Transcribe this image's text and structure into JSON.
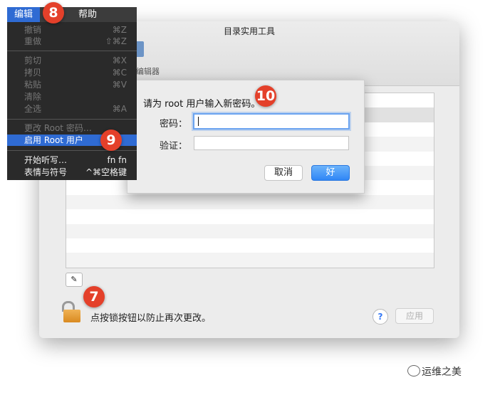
{
  "window": {
    "title": "目录实用工具",
    "toolbar_label": "编辑器",
    "lock_text": "点按锁按钮以防止再次更改。",
    "help_label": "?",
    "apply_label": "应用",
    "edit_icon": "✎"
  },
  "dialog": {
    "title": "请为 root 用户输入新密码。",
    "password_label": "密码：",
    "verify_label": "验证：",
    "cancel_label": "取消",
    "ok_label": "好"
  },
  "menubar": {
    "edit": "编辑",
    "help": "帮助"
  },
  "menu": {
    "items": [
      {
        "label": "撤销",
        "shortcut": "⌘Z"
      },
      {
        "label": "重做",
        "shortcut": "⇧⌘Z"
      },
      {
        "label": "剪切",
        "shortcut": "⌘X"
      },
      {
        "label": "拷贝",
        "shortcut": "⌘C"
      },
      {
        "label": "粘贴",
        "shortcut": "⌘V"
      },
      {
        "label": "清除",
        "shortcut": ""
      },
      {
        "label": "全选",
        "shortcut": "⌘A"
      },
      {
        "label": "更改 Root 密码…",
        "shortcut": ""
      },
      {
        "label": "启用 Root 用户",
        "shortcut": ""
      },
      {
        "label": "开始听写…",
        "shortcut": "fn fn"
      },
      {
        "label": "表情与符号",
        "shortcut": "^⌘空格键"
      }
    ]
  },
  "badges": {
    "b7": "7",
    "b8": "8",
    "b9": "9",
    "b10": "10"
  },
  "watermark": "运维之美",
  "colors": {
    "accent": "#2f6bd3",
    "badge": "#e4402a",
    "ok_button": "#2f86f6"
  }
}
